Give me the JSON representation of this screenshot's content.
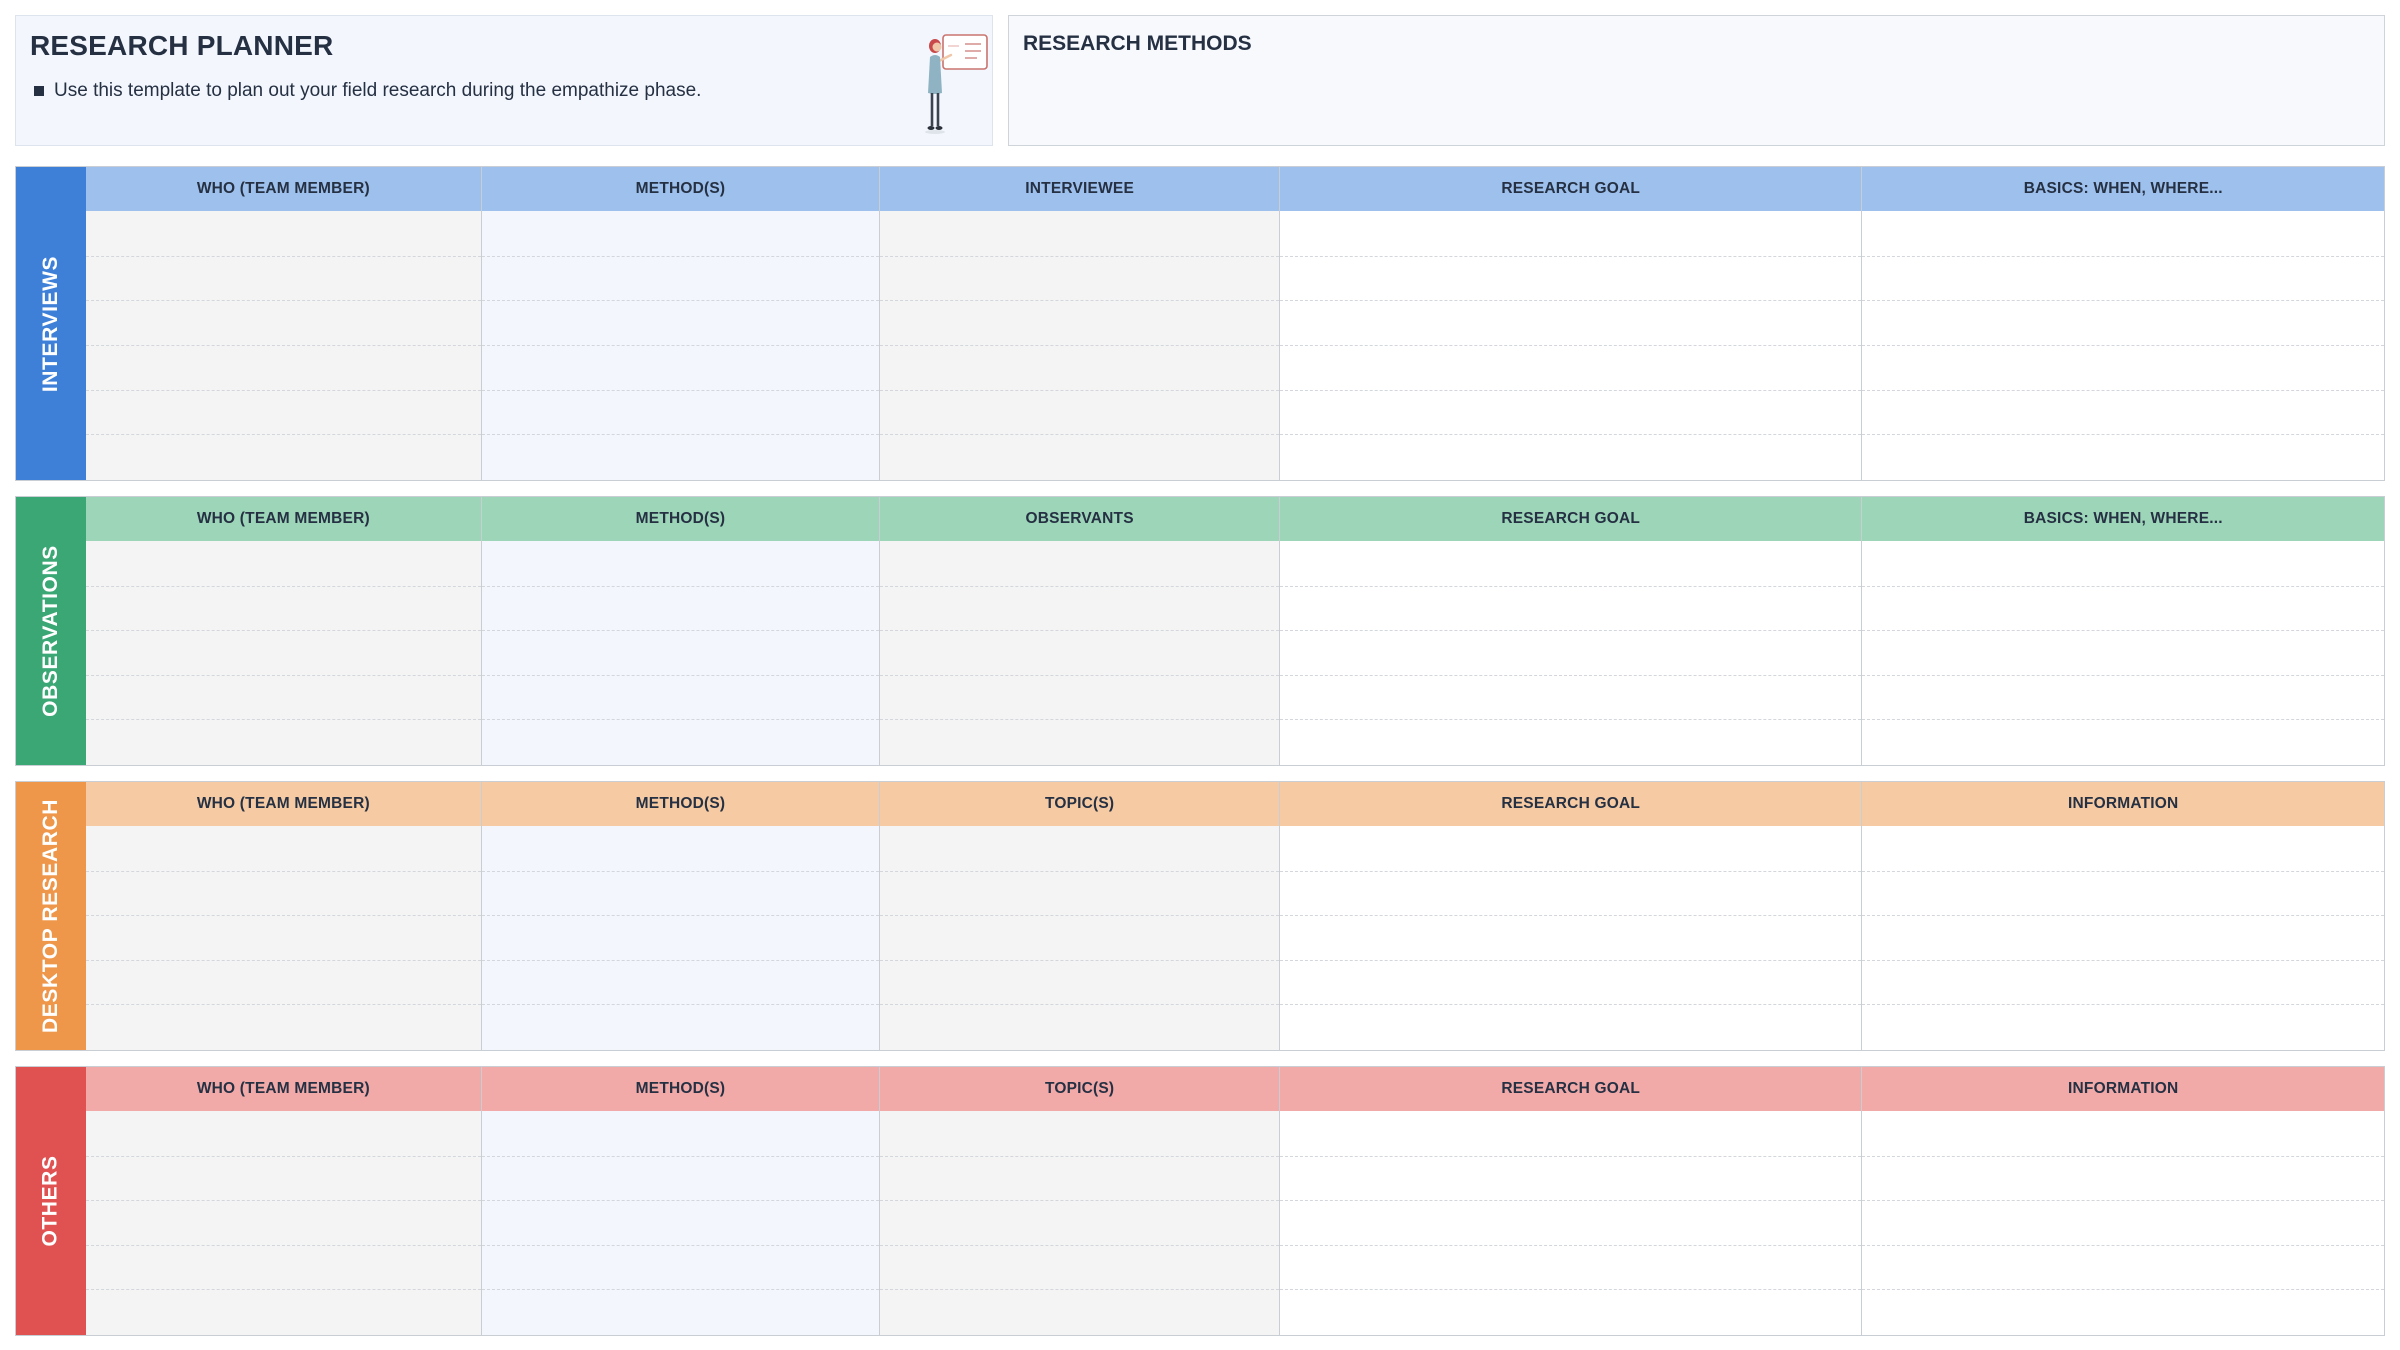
{
  "header": {
    "title": "RESEARCH PLANNER",
    "description": "Use this template to plan out your field research during the empathize phase.",
    "illustration_icon": "person-presenting-whiteboard-icon"
  },
  "methods": {
    "title": "RESEARCH METHODS"
  },
  "sections": [
    {
      "label": "INTERVIEWS",
      "color": "#3e80d8",
      "header_color": "#9ec0ec",
      "columns": [
        "WHO (TEAM MEMBER)",
        "METHOD(S)",
        "INTERVIEWEE",
        "RESEARCH GOAL",
        "BASICS: WHEN, WHERE..."
      ]
    },
    {
      "label": "OBSERVATIONS",
      "color": "#3aa774",
      "header_color": "#9dd5b8",
      "columns": [
        "WHO (TEAM MEMBER)",
        "METHOD(S)",
        "OBSERVANTS",
        "RESEARCH GOAL",
        "BASICS: WHEN, WHERE..."
      ]
    },
    {
      "label": "DESKTOP RESEARCH",
      "color": "#ee964a",
      "header_color": "#f6cba3",
      "columns": [
        "WHO (TEAM MEMBER)",
        "METHOD(S)",
        "TOPIC(S)",
        "RESEARCH GOAL",
        "INFORMATION"
      ]
    },
    {
      "label": "OTHERS",
      "color": "#e05252",
      "header_color": "#f2aaa9",
      "columns": [
        "WHO (TEAM MEMBER)",
        "METHOD(S)",
        "TOPIC(S)",
        "RESEARCH GOAL",
        "INFORMATION"
      ]
    }
  ]
}
